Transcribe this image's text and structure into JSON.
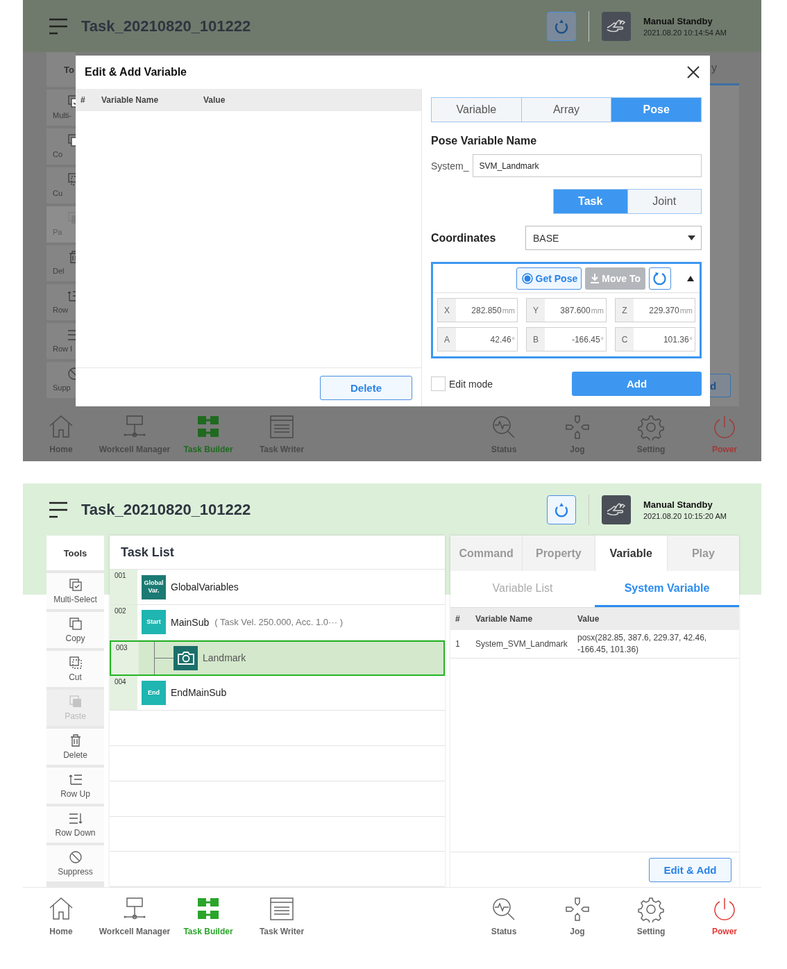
{
  "top_screen": {
    "header": {
      "title": "Task_20210820_101222",
      "mode": "Manual Standby",
      "datetime": "2021.08.20 10:14:54 AM"
    },
    "behind": {
      "tools_title": "To",
      "tools": [
        {
          "label": "Multi-",
          "kind": "multi_select",
          "disabled": false
        },
        {
          "label": "Co",
          "kind": "copy",
          "disabled": false
        },
        {
          "label": "Cu",
          "kind": "cut",
          "disabled": false
        },
        {
          "label": "Pa",
          "kind": "paste",
          "disabled": true
        },
        {
          "label": "Del",
          "kind": "delete",
          "disabled": false
        },
        {
          "label": "Row",
          "kind": "row_up",
          "disabled": false
        },
        {
          "label": "Row I",
          "kind": "row_down",
          "disabled": false
        },
        {
          "label": "Supp",
          "kind": "suppress",
          "disabled": false
        }
      ],
      "tab_fragment": "y",
      "button_fragment": "d"
    },
    "dialog": {
      "title": "Edit & Add Variable",
      "columns": [
        "#",
        "Variable Name",
        "Value"
      ],
      "delete_button": "Delete",
      "type_tabs": [
        {
          "label": "Variable",
          "selected": false
        },
        {
          "label": "Array",
          "selected": false
        },
        {
          "label": "Pose",
          "selected": true
        }
      ],
      "name_label": "Pose Variable Name",
      "prefix": "System_",
      "name_value": "SVM_Landmark",
      "space_tabs": [
        {
          "label": "Task",
          "selected": true
        },
        {
          "label": "Joint",
          "selected": false
        }
      ],
      "coordinates": {
        "label": "Coordinates",
        "value": "BASE"
      },
      "pose": {
        "get_pose": "Get Pose",
        "move_to": {
          "label": "Move To",
          "disabled": true
        },
        "expanded": true,
        "fields": [
          {
            "axis": "X",
            "value": "282.850",
            "unit": "mm"
          },
          {
            "axis": "Y",
            "value": "387.600",
            "unit": "mm"
          },
          {
            "axis": "Z",
            "value": "229.370",
            "unit": "mm"
          },
          {
            "axis": "A",
            "value": "42.46",
            "unit": "°"
          },
          {
            "axis": "B",
            "value": "-166.45",
            "unit": "°"
          },
          {
            "axis": "C",
            "value": "101.36",
            "unit": "°"
          }
        ]
      },
      "edit_mode": {
        "label": "Edit mode",
        "checked": false
      },
      "add_button": "Add"
    },
    "nav": {
      "left": [
        {
          "label": "Home",
          "kind": "home",
          "selected": false
        },
        {
          "label": "Workcell Manager",
          "kind": "workcell",
          "selected": false
        },
        {
          "label": "Task Builder",
          "kind": "builder",
          "selected": true
        },
        {
          "label": "Task Writer",
          "kind": "writer",
          "selected": false
        }
      ],
      "right": [
        {
          "label": "Status",
          "kind": "status",
          "selected": false
        },
        {
          "label": "Jog",
          "kind": "jog",
          "selected": false
        },
        {
          "label": "Setting",
          "kind": "setting",
          "selected": false
        },
        {
          "label": "Power",
          "kind": "power",
          "selected": false
        }
      ]
    }
  },
  "bottom_screen": {
    "header": {
      "title": "Task_20210820_101222",
      "mode": "Manual Standby",
      "datetime": "2021.08.20 10:15:20 AM"
    },
    "tools_title": "Tools",
    "tools": [
      {
        "label": "Multi-Select",
        "kind": "multi_select",
        "disabled": false
      },
      {
        "label": "Copy",
        "kind": "copy",
        "disabled": false
      },
      {
        "label": "Cut",
        "kind": "cut",
        "disabled": false
      },
      {
        "label": "Paste",
        "kind": "paste",
        "disabled": true
      },
      {
        "label": "Delete",
        "kind": "delete",
        "disabled": false
      },
      {
        "label": "Row Up",
        "kind": "row_up",
        "disabled": false
      },
      {
        "label": "Row Down",
        "kind": "row_down",
        "disabled": false
      },
      {
        "label": "Suppress",
        "kind": "suppress",
        "disabled": false
      }
    ],
    "task_list": {
      "title": "Task List",
      "rows": [
        {
          "number": "001",
          "kind": "global",
          "badge": "Global Var.",
          "name": "GlobalVariables",
          "selected": false
        },
        {
          "number": "002",
          "kind": "start",
          "badge": "Start",
          "name": "MainSub",
          "detail": "( Task Vel. 250.000, Acc. 1.0··· )",
          "selected": false,
          "children": [
            {
              "number": "003",
              "kind": "camera",
              "name": "Landmark",
              "selected": true
            }
          ]
        },
        {
          "number": "004",
          "kind": "end",
          "badge": "End",
          "name": "EndMainSub",
          "selected": false
        }
      ]
    },
    "tabs": [
      {
        "label": "Command",
        "selected": false
      },
      {
        "label": "Property",
        "selected": false
      },
      {
        "label": "Variable",
        "selected": true
      },
      {
        "label": "Play",
        "selected": false
      }
    ],
    "subtabs": [
      {
        "label": "Variable List",
        "selected": false
      },
      {
        "label": "System Variable",
        "selected": true
      }
    ],
    "variables": {
      "columns": [
        "#",
        "Variable Name",
        "Value"
      ],
      "rows": [
        {
          "number": "1",
          "name": "System_SVM_Landmark",
          "value": "posx(282.85, 387.6, 229.37, 42.46, -166.45, 101.36)"
        }
      ]
    },
    "edit_add_button": "Edit & Add",
    "nav": {
      "left": [
        {
          "label": "Home",
          "kind": "home",
          "selected": false
        },
        {
          "label": "Workcell Manager",
          "kind": "workcell",
          "selected": false
        },
        {
          "label": "Task Builder",
          "kind": "builder",
          "selected": true
        },
        {
          "label": "Task Writer",
          "kind": "writer",
          "selected": false
        }
      ],
      "right": [
        {
          "label": "Status",
          "kind": "status",
          "selected": false
        },
        {
          "label": "Jog",
          "kind": "jog",
          "selected": false
        },
        {
          "label": "Setting",
          "kind": "setting",
          "selected": false
        },
        {
          "label": "Power",
          "kind": "power",
          "selected": false
        }
      ]
    }
  }
}
